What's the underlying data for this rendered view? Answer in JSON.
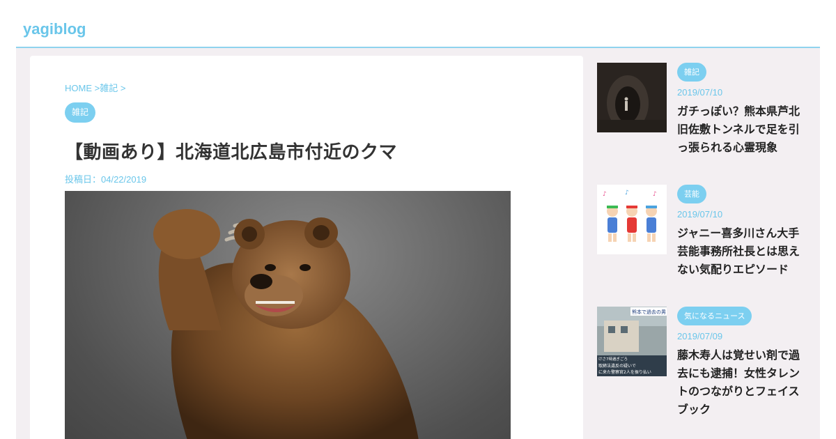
{
  "header": {
    "logo": "yagiblog"
  },
  "article": {
    "breadcrumb": {
      "home": "HOME",
      "sep1": " >",
      "category": "雑記",
      "sep2": " >"
    },
    "category_badge": "雑記",
    "title": "【動画あり】北海道北広島市付近のクマ",
    "date": "投稿日：04/22/2019"
  },
  "sidebar": {
    "items": [
      {
        "category": "雑記",
        "date": "2019/07/10",
        "title": "ガチっぽい？熊本県芦北旧佐敷トンネルで足を引っ張られる心霊現象"
      },
      {
        "category": "芸能",
        "date": "2019/07/10",
        "title": "ジャニー喜多川さん大手芸能事務所社長とは思えない気配りエピソード"
      },
      {
        "category": "気になるニュース",
        "date": "2019/07/09",
        "title": "藤木寿人は覚せい剤で過去にも逮捕！女性タレントのつながりとフェイスブック",
        "thumb_text": {
          "banner": "熊本で過去の男",
          "caption1": "けさ7時過ぎごろ",
          "caption2": "取締法違反の疑いで",
          "caption3": "に来た警察官2人を振り払い"
        }
      }
    ]
  }
}
